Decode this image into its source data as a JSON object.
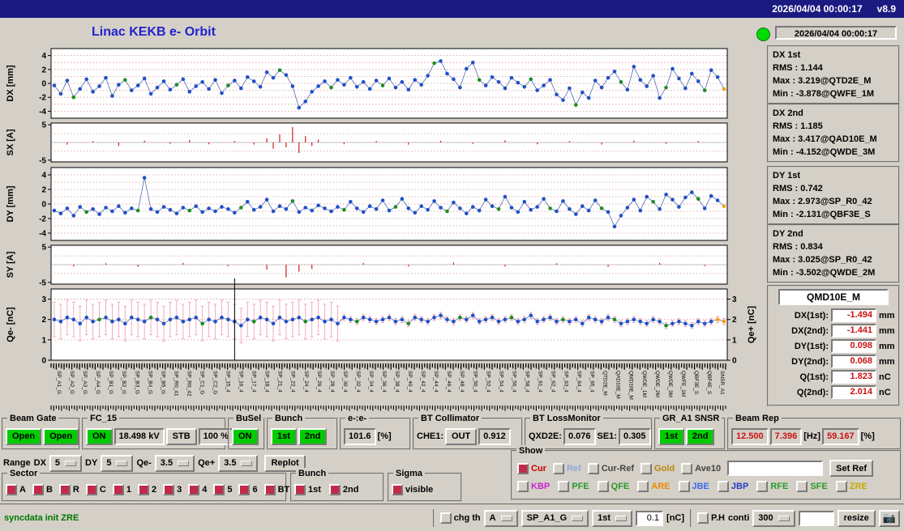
{
  "header": {
    "datetime": "2026/04/04 00:00:17",
    "version": "v8.9"
  },
  "title": "Linac KEKB e- Orbit",
  "clock": "2026/04/04 00:00:17",
  "colors": {
    "accent_blue": "#2050c8",
    "data_green": "#1e8c1e",
    "data_orange": "#f5a020",
    "data_red": "#cc2020",
    "error_pink": "#f2aabe",
    "grid": "#d89898",
    "button_green": "#00cc00",
    "value_red": "#cc1111",
    "titlebar_navy": "#1a1a80",
    "status_green": "#00dd00",
    "msg_green": "#007700"
  },
  "stats": [
    {
      "title": "DX 1st",
      "lines": [
        "RMS : 1.144",
        "Max : 3.219@QTD2E_M",
        "Min : -3.878@QWFE_1M"
      ]
    },
    {
      "title": "DX 2nd",
      "lines": [
        "RMS : 1.185",
        "Max : 3.417@QAD10E_M",
        "Min : -4.152@QWDE_3M"
      ]
    },
    {
      "title": "DY 1st",
      "lines": [
        "RMS : 0.742",
        "Max : 2.973@SP_R0_42",
        "Min : -2.131@QBF3E_S"
      ]
    },
    {
      "title": "DY 2nd",
      "lines": [
        "RMS : 0.834",
        "Max : 3.025@SP_R0_42",
        "Min : -3.502@QWDE_2M"
      ]
    }
  ],
  "qmd": {
    "title": "QMD10E_M",
    "rows": [
      {
        "label": "DX(1st):",
        "value": "-1.494",
        "unit": "mm"
      },
      {
        "label": "DX(2nd):",
        "value": "-1.441",
        "unit": "mm"
      },
      {
        "label": "DY(1st):",
        "value": "0.098",
        "unit": "mm"
      },
      {
        "label": "DY(2nd):",
        "value": "0.068",
        "unit": "mm"
      },
      {
        "label": "Q(1st):",
        "value": "1.823",
        "unit": "nC"
      },
      {
        "label": "Q(2nd):",
        "value": "2.014",
        "unit": "nC"
      }
    ]
  },
  "chart_data": [
    {
      "type": "scatter",
      "name": "DX",
      "ylabel": "DX [mm]",
      "ylim": [
        -5,
        5
      ],
      "yticks": [
        4,
        2,
        0,
        -2,
        -4
      ],
      "values": [
        -0.3,
        -1.5,
        0.4,
        -2.0,
        -0.8,
        0.6,
        -1.2,
        -0.4,
        0.8,
        -1.8,
        -0.2,
        0.5,
        -1.0,
        -0.3,
        0.7,
        -1.5,
        -0.6,
        0.3,
        -0.9,
        -0.2,
        0.6,
        -1.2,
        -0.4,
        0.2,
        -0.8,
        0.5,
        -1.4,
        -0.3,
        0.4,
        -0.7,
        0.9,
        0.3,
        -0.5,
        1.6,
        0.8,
        1.9,
        1.2,
        -0.4,
        -3.5,
        -2.6,
        -1.2,
        -0.4,
        0.3,
        -0.6,
        0.5,
        -0.2,
        0.8,
        -0.5,
        0.2,
        -0.8,
        0.4,
        -0.3,
        0.7,
        -0.6,
        0.2,
        -0.9,
        0.5,
        -0.2,
        1.1,
        2.9,
        3.2,
        1.4,
        0.6,
        -0.6,
        2.1,
        3.0,
        0.5,
        -0.3,
        0.9,
        0.2,
        -0.7,
        0.8,
        0.1,
        -0.5,
        0.6,
        -1.0,
        -0.3,
        0.5,
        -1.6,
        -2.4,
        -0.7,
        -3.1,
        -1.3,
        -2.1,
        0.4,
        -0.6,
        0.8,
        1.7,
        0.2,
        -0.9,
        2.4,
        0.5,
        -0.4,
        1.1,
        -2.1,
        -0.6,
        2.1,
        0.7,
        -0.7,
        1.4,
        0.3,
        -1.0,
        1.9,
        0.9,
        -0.8
      ],
      "green_idx": [
        3,
        11,
        19,
        27,
        35,
        43,
        51,
        59,
        66,
        74,
        81,
        88,
        95,
        101
      ],
      "orange_idx": [
        104
      ]
    },
    {
      "type": "bar",
      "name": "SX",
      "ylabel": "SX [A]",
      "ylim": [
        -5.5,
        5.5
      ],
      "yticks": [
        5,
        -5
      ],
      "values": [
        0,
        0,
        -0.6,
        0,
        0,
        0,
        0.4,
        0,
        0,
        0,
        -1.0,
        0,
        0,
        0,
        0.5,
        0,
        0,
        0,
        -0.4,
        0,
        0,
        0.7,
        0,
        0,
        -0.5,
        0,
        0,
        0,
        0.4,
        0,
        0,
        -0.6,
        0,
        1.2,
        -1.8,
        2.3,
        -1.4,
        4.4,
        -3.0,
        1.8,
        -1.0,
        0.8,
        0,
        0,
        0,
        -0.5,
        0,
        0,
        0,
        0,
        0.4,
        0,
        0,
        0,
        0,
        -0.6,
        0,
        0,
        0,
        0,
        0.5,
        0,
        0,
        0,
        0,
        -0.4,
        0,
        0,
        0,
        0,
        0.6,
        0,
        0,
        0,
        0,
        -0.5,
        0,
        0,
        0,
        0,
        0.4,
        0,
        0,
        0,
        0,
        -0.6,
        0,
        0,
        0,
        0,
        0.5,
        0,
        0,
        0,
        0,
        -0.4,
        0,
        0,
        0,
        0,
        0.4,
        0,
        0,
        0,
        0
      ]
    },
    {
      "type": "scatter",
      "name": "DY",
      "ylabel": "DY [mm]",
      "ylim": [
        -5,
        5
      ],
      "yticks": [
        4,
        2,
        0,
        -2,
        -4
      ],
      "values": [
        -0.9,
        -1.3,
        -0.6,
        -1.6,
        -0.4,
        -1.1,
        -0.7,
        -1.4,
        -0.5,
        -1.0,
        -0.3,
        -1.2,
        -0.6,
        -0.9,
        3.6,
        -0.7,
        -1.1,
        -0.4,
        -0.8,
        -1.3,
        -0.5,
        -0.9,
        -0.3,
        -1.1,
        -0.6,
        -1.0,
        -0.4,
        -0.7,
        -1.2,
        -0.5,
        0.3,
        -0.8,
        -0.4,
        0.6,
        -1.0,
        -0.3,
        -0.7,
        0.4,
        -1.1,
        -0.5,
        -0.9,
        -0.2,
        -0.6,
        -1.0,
        -0.4,
        -0.8,
        0.3,
        -0.6,
        -1.1,
        -0.3,
        -0.7,
        0.5,
        -0.9,
        -0.4,
        0.7,
        -0.6,
        -1.2,
        -0.3,
        -0.8,
        0.4,
        -0.5,
        -1.0,
        0.2,
        -0.6,
        -1.3,
        -0.4,
        -0.9,
        0.6,
        -0.3,
        -0.7,
        1.0,
        -0.5,
        -1.1,
        0.3,
        -0.8,
        -0.4,
        0.7,
        -0.6,
        -1.0,
        0.4,
        -0.7,
        -1.4,
        -0.3,
        -0.9,
        0.5,
        -0.6,
        -1.1,
        -3.1,
        -1.6,
        -0.5,
        0.6,
        -0.9,
        1.0,
        0.3,
        -0.7,
        1.3,
        0.6,
        -0.4,
        0.9,
        1.6,
        0.7,
        -0.6,
        1.1,
        0.5,
        -0.3
      ],
      "green_idx": [
        5,
        13,
        21,
        29,
        37,
        45,
        53,
        61,
        69,
        77,
        85,
        93,
        100
      ],
      "orange_idx": [
        104
      ]
    },
    {
      "type": "bar",
      "name": "SY",
      "ylabel": "SY [A]",
      "ylim": [
        -5.5,
        5.5
      ],
      "yticks": [
        5,
        -5
      ],
      "values": [
        0,
        0,
        0,
        -0.5,
        0,
        0,
        0,
        0,
        0.4,
        0,
        0,
        0,
        0,
        -0.6,
        0,
        0,
        0,
        0,
        0,
        0,
        0.5,
        0,
        0,
        0,
        0,
        0,
        0,
        -0.4,
        0,
        0,
        0,
        0,
        0,
        -1.4,
        0,
        0,
        -3.6,
        0,
        -2.0,
        0,
        -1.2,
        0,
        0,
        0,
        0,
        0,
        0,
        0,
        0.5,
        0,
        0,
        0,
        0,
        0,
        0,
        -0.5,
        0,
        0,
        0,
        0,
        0,
        0,
        0.6,
        0,
        0,
        0,
        0,
        0,
        0,
        0,
        -0.5,
        0,
        0,
        0,
        0,
        0,
        0,
        0,
        0.4,
        0,
        0,
        0,
        0,
        0,
        0,
        0,
        -0.6,
        0,
        0,
        0,
        0,
        0,
        0,
        0,
        0.5,
        0,
        0,
        0,
        0,
        0,
        0,
        -0.4,
        0,
        0,
        0
      ]
    },
    {
      "type": "scatter-error",
      "name": "Qe-",
      "ylabel": "Qe- [nC]",
      "ylabel_right": "Qe+ [nC]",
      "ylim": [
        0,
        3.5
      ],
      "yticks": [
        3,
        2,
        1,
        0
      ],
      "yticks_right": [
        3,
        2,
        1,
        0
      ],
      "values": [
        2.0,
        1.9,
        2.1,
        2.0,
        1.8,
        2.1,
        1.9,
        2.0,
        2.1,
        1.9,
        2.0,
        1.8,
        2.1,
        2.0,
        1.9,
        2.1,
        2.0,
        1.8,
        2.0,
        2.1,
        1.9,
        2.0,
        2.1,
        1.8,
        2.0,
        1.9,
        2.1,
        2.0,
        1.9,
        1.7,
        2.0,
        1.9,
        2.1,
        2.0,
        1.8,
        2.1,
        1.9,
        2.0,
        2.1,
        1.9,
        2.0,
        2.1,
        1.9,
        2.0,
        1.8,
        2.1,
        2.0,
        1.9,
        2.1,
        2.0,
        1.9,
        2.0,
        2.1,
        1.9,
        2.0,
        1.8,
        2.1,
        2.0,
        1.9,
        2.1,
        2.2,
        2.0,
        1.9,
        2.1,
        2.0,
        2.2,
        1.9,
        2.0,
        2.1,
        1.9,
        2.0,
        2.1,
        1.9,
        2.0,
        2.2,
        1.9,
        2.0,
        2.1,
        1.9,
        2.0,
        1.9,
        2.0,
        1.8,
        2.1,
        2.0,
        1.9,
        2.1,
        2.0,
        1.8,
        1.9,
        2.0,
        1.9,
        1.8,
        2.0,
        1.9,
        1.7,
        1.8,
        1.9,
        1.8,
        1.7,
        1.9,
        1.8,
        1.9,
        2.0,
        1.9
      ],
      "green_idx": [
        7,
        15,
        23,
        31,
        39,
        47,
        55,
        63,
        71,
        79,
        87,
        95
      ],
      "orange_idx": [
        103,
        104
      ],
      "error_large": 0.85,
      "error_small": 0.15,
      "error_large_until": 45,
      "cursor_index": 28
    }
  ],
  "bpm_labels": [
    "SP_A1_G",
    "SP_A2_G",
    "SP_A3_G",
    "SP_A4_G",
    "SP_B1_G",
    "SP_B2_G",
    "SP_B3_G",
    "SP_B4_G",
    "SP_B5_G",
    "SP_R0_41",
    "SP_R0_42",
    "SP_C1_G",
    "SP_C2_G",
    "SP_15_4",
    "SP_16_4",
    "SP_17_4",
    "SP_18_4",
    "SP_21_4",
    "SP_22_4",
    "SP_24_4",
    "SP_26_4",
    "SP_28_4",
    "SP_30_4",
    "SP_32_4",
    "SP_34_4",
    "SP_36_4",
    "SP_38_4",
    "SP_40_4",
    "SP_42_4",
    "SP_44_4",
    "SP_46_4",
    "SP_48_4",
    "SP_50_4",
    "SP_52_4",
    "SP_54_4",
    "SP_56_4",
    "SP_58_4",
    "SP_61_4",
    "SP_62_4",
    "SP_63_4",
    "SP_64_4",
    "SP_65_4",
    "QTD2E_M",
    "QAD10E_M",
    "QMD10E_M",
    "QWDE_1M",
    "QWDE_2M",
    "QWDE_3M",
    "QWFE_1M",
    "QBF3E_S",
    "QBF4E_S",
    "SNSR_A1"
  ],
  "panels": {
    "beam_gate": {
      "title": "Beam Gate",
      "open1": "Open",
      "open2": "Open"
    },
    "fc15": {
      "title": "FC_15",
      "on": "ON",
      "kv": "18.498 kV",
      "stb": "STB",
      "pct": "100 %"
    },
    "busel": {
      "title": "BuSel",
      "on": "ON"
    },
    "bunch": {
      "title": "Bunch",
      "b1": "1st",
      "b2": "2nd"
    },
    "ee": {
      "title": "e-:e-",
      "value": "101.6",
      "unit": "[%]"
    },
    "bt_collimator": {
      "title": "BT Collimator",
      "che1": "CHE1:",
      "state": "OUT",
      "value": "0.912"
    },
    "bt_lossmonitor": {
      "title": "BT LossMonitor",
      "qxd2e_label": "QXD2E:",
      "qxd2e": "0.076",
      "se1_label": "SE1:",
      "se1": "0.305"
    },
    "gr_a1": {
      "title": "GR_A1 SNSR",
      "b1": "1st",
      "b2": "2nd"
    },
    "beam_rep": {
      "title": "Beam Rep",
      "v1": "12.500",
      "v2": "7.396",
      "hz": "[Hz]",
      "v3": "59.167",
      "pct": "[%]"
    }
  },
  "range_row": {
    "label": "Range",
    "dx_label": "DX",
    "dx": "5",
    "dy_label": "DY",
    "dy": "5",
    "qem_label": "Qe-",
    "qem": "3.5",
    "qep_label": "Qe+",
    "qep": "3.5",
    "replot": "Replot"
  },
  "show": {
    "title": "Show",
    "row1": [
      {
        "label": "Cur",
        "color": "#cc0000",
        "checked": true
      },
      {
        "label": "Ref",
        "color": "#8fa8d8",
        "checked": false
      },
      {
        "label": "Cur-Ref",
        "color": "#444444",
        "checked": false
      },
      {
        "label": "Gold",
        "color": "#b8860b",
        "checked": false
      },
      {
        "label": "Ave10",
        "color": "#444444",
        "checked": false
      }
    ],
    "entry": "",
    "set_ref": "Set Ref",
    "row2": [
      {
        "label": "KBP",
        "color": "#cc22cc",
        "checked": false
      },
      {
        "label": "PFE",
        "color": "#2a9a2a",
        "checked": false
      },
      {
        "label": "QFE",
        "color": "#2a9a2a",
        "checked": false
      },
      {
        "label": "ARE",
        "color": "#ee8800",
        "checked": false
      },
      {
        "label": "JBE",
        "color": "#3a6aee",
        "checked": false
      },
      {
        "label": "JBP",
        "color": "#2a3acc",
        "checked": false
      },
      {
        "label": "RFE",
        "color": "#2a9a2a",
        "checked": false
      },
      {
        "label": "SFE",
        "color": "#2a9a2a",
        "checked": false
      },
      {
        "label": "ZRE",
        "color": "#c8a800",
        "checked": false
      }
    ]
  },
  "sector": {
    "title": "Sector",
    "items": [
      "A",
      "B",
      "R",
      "C",
      "1",
      "2",
      "3",
      "4",
      "5",
      "6",
      "BT"
    ]
  },
  "bunch_sel": {
    "title": "Bunch",
    "items": [
      "1st",
      "2nd"
    ]
  },
  "sigma": {
    "title": "Sigma",
    "items": [
      "visible"
    ]
  },
  "statusbar": {
    "message": "syncdata init ZRE",
    "chg_th": "chg th",
    "select_a": "A",
    "select_bpm": "SP_A1_G",
    "select_bunch": "1st",
    "threshold": "0.1",
    "unit": "[nC]",
    "ph": "P.H",
    "conti": "conti",
    "rep": "300",
    "entry2": "",
    "resize": "resize",
    "camera_glyph": "📷"
  }
}
